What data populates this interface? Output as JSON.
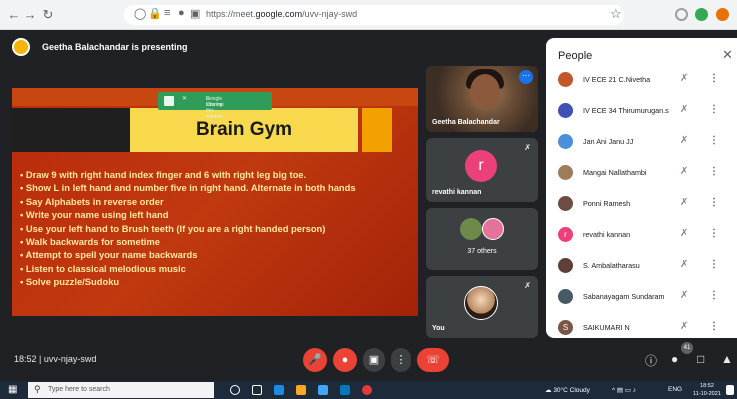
{
  "browser": {
    "url_prefix": "https://meet.",
    "url_domain": "google.com",
    "url_path": "/uvv-njay-swd"
  },
  "presenter": {
    "text": "Geetha Balachandar is presenting"
  },
  "slide": {
    "chip_line1": "Google Chrome",
    "chip_line2": "is sharing this window",
    "title": "Brain Gym",
    "bullets": [
      "Draw 9 with right hand index finger and 6 with right leg big toe.",
      "Show L in left hand and number five in right hand. Alternate in both hands",
      "Say Alphabets in reverse order",
      "Write your name using left hand",
      "Use your left hand to Brush teeth (If you are a right handed person)",
      "Walk backwards for sometime",
      "Attempt to spell your name backwards",
      "Listen to classical melodious music",
      "Solve puzzle/Sudoku"
    ]
  },
  "tiles": {
    "presenter_name": "Geetha Balachandar",
    "revathi_initial": "r",
    "revathi_name": "revathi kannan",
    "others": "37 others",
    "you": "You"
  },
  "people": {
    "title": "People",
    "close_icon": "close-icon",
    "list": [
      {
        "name": "IV ECE 21 C.Nivetha",
        "initial": "",
        "color": "#c0582a"
      },
      {
        "name": "IV ECE 34 Thirumurugan.s",
        "initial": "",
        "color": "#3f51b5"
      },
      {
        "name": "Jan Ani Janu JJ",
        "initial": "",
        "color": "#4a90d9"
      },
      {
        "name": "Mangai Nallathambi",
        "initial": "",
        "color": "#9e7b5a"
      },
      {
        "name": "Ponni Ramesh",
        "initial": "",
        "color": "#6d4c41"
      },
      {
        "name": "revathi kannan",
        "initial": "r",
        "color": "#ec407a"
      },
      {
        "name": "S. Ambalatharasu",
        "initial": "",
        "color": "#5d4037"
      },
      {
        "name": "Sabanayagam Sundaram",
        "initial": "",
        "color": "#455a64"
      },
      {
        "name": "SAIKUMARI N",
        "initial": "S",
        "color": "#795548"
      }
    ]
  },
  "bottom": {
    "meeting_info": "18:52 | uvv-njay-swd",
    "participants_count": "41"
  },
  "taskbar": {
    "search_placeholder": "Type here to search",
    "weather": "30°C Cloudy",
    "lang": "ENG",
    "time": "18:52",
    "date": "11-10-2021"
  },
  "colors": {
    "end_call": "#ea4335",
    "meet_bg": "#202124",
    "slide_bg": "#b82a0c"
  }
}
